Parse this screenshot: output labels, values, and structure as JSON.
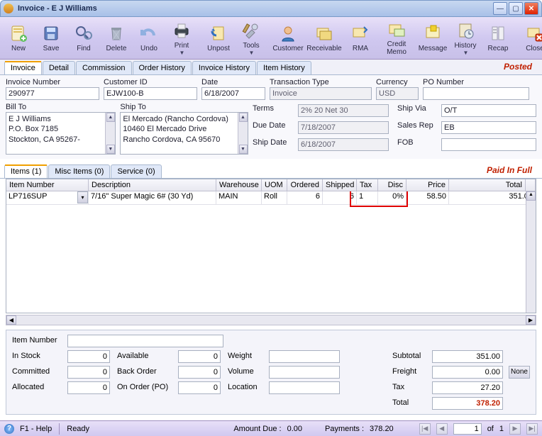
{
  "window": {
    "title": "Invoice - E J Williams"
  },
  "toolbar": {
    "new": "New",
    "save": "Save",
    "find": "Find",
    "delete": "Delete",
    "undo": "Undo",
    "print": "Print",
    "unpost": "Unpost",
    "tools": "Tools",
    "customer": "Customer",
    "receivable": "Receivable",
    "rma": "RMA",
    "credit_memo": "Credit Memo",
    "message": "Message",
    "history": "History",
    "recap": "Recap",
    "close": "Close"
  },
  "main_tabs": [
    "Invoice",
    "Detail",
    "Commission",
    "Order History",
    "Invoice History",
    "Item History"
  ],
  "status_stamp": "Posted",
  "header": {
    "labels": {
      "invoice_no": "Invoice Number",
      "customer_id": "Customer ID",
      "date": "Date",
      "txn_type": "Transaction Type",
      "currency": "Currency",
      "po_no": "PO Number",
      "bill_to": "Bill To",
      "ship_to": "Ship To",
      "terms": "Terms",
      "due_date": "Due Date",
      "ship_date": "Ship Date",
      "ship_via": "Ship Via",
      "sales_rep": "Sales Rep",
      "fob": "FOB"
    },
    "invoice_no": "290977",
    "customer_id": "EJW100-B",
    "date": "6/18/2007",
    "txn_type": "Invoice",
    "currency": "USD",
    "po_no": "",
    "bill_to": "E J Williams\nP.O. Box 7185\nStockton, CA 95267-",
    "ship_to": "El Mercado (Rancho Cordova)\n10460 El Mercado Drive\nRancho Cordova, CA 95670",
    "terms": "2% 20 Net 30",
    "due_date": "7/18/2007",
    "ship_date": "6/18/2007",
    "ship_via": "O/T",
    "sales_rep": "EB",
    "fob": ""
  },
  "items_tabs": [
    "Items (1)",
    "Misc Items (0)",
    "Service (0)"
  ],
  "paid_stamp": "Paid In Full",
  "grid": {
    "columns": [
      "Item Number",
      "Description",
      "Warehouse",
      "UOM",
      "Ordered",
      "Shipped",
      "Tax",
      "Disc",
      "Price",
      "Total"
    ],
    "rows": [
      {
        "item": "LP716SUP",
        "desc": "7/16\" Super Magic 6# (30 Yd)",
        "wh": "MAIN",
        "uom": "Roll",
        "ordered": "6",
        "shipped": "6",
        "tax": "1",
        "disc": "0%",
        "price": "58.50",
        "total": "351.00"
      }
    ]
  },
  "bottom": {
    "labels": {
      "item_number": "Item Number",
      "in_stock": "In Stock",
      "available": "Available",
      "committed": "Committed",
      "back_order": "Back Order",
      "allocated": "Allocated",
      "on_order_po": "On Order (PO)",
      "weight": "Weight",
      "volume": "Volume",
      "location": "Location",
      "subtotal": "Subtotal",
      "freight": "Freight",
      "tax": "Tax",
      "total": "Total",
      "none_btn": "None"
    },
    "item_number": "",
    "in_stock": "0",
    "available": "0",
    "committed": "0",
    "back_order": "0",
    "allocated": "0",
    "on_order_po": "0",
    "weight": "",
    "volume": "",
    "location": "",
    "subtotal": "351.00",
    "freight": "0.00",
    "tax": "27.20",
    "total": "378.20"
  },
  "statusbar": {
    "help": "F1 - Help",
    "ready": "Ready",
    "amount_due_label": "Amount Due :",
    "amount_due": "0.00",
    "payments_label": "Payments :",
    "payments": "378.20",
    "page": "1",
    "of_label": "of",
    "pages": "1"
  }
}
